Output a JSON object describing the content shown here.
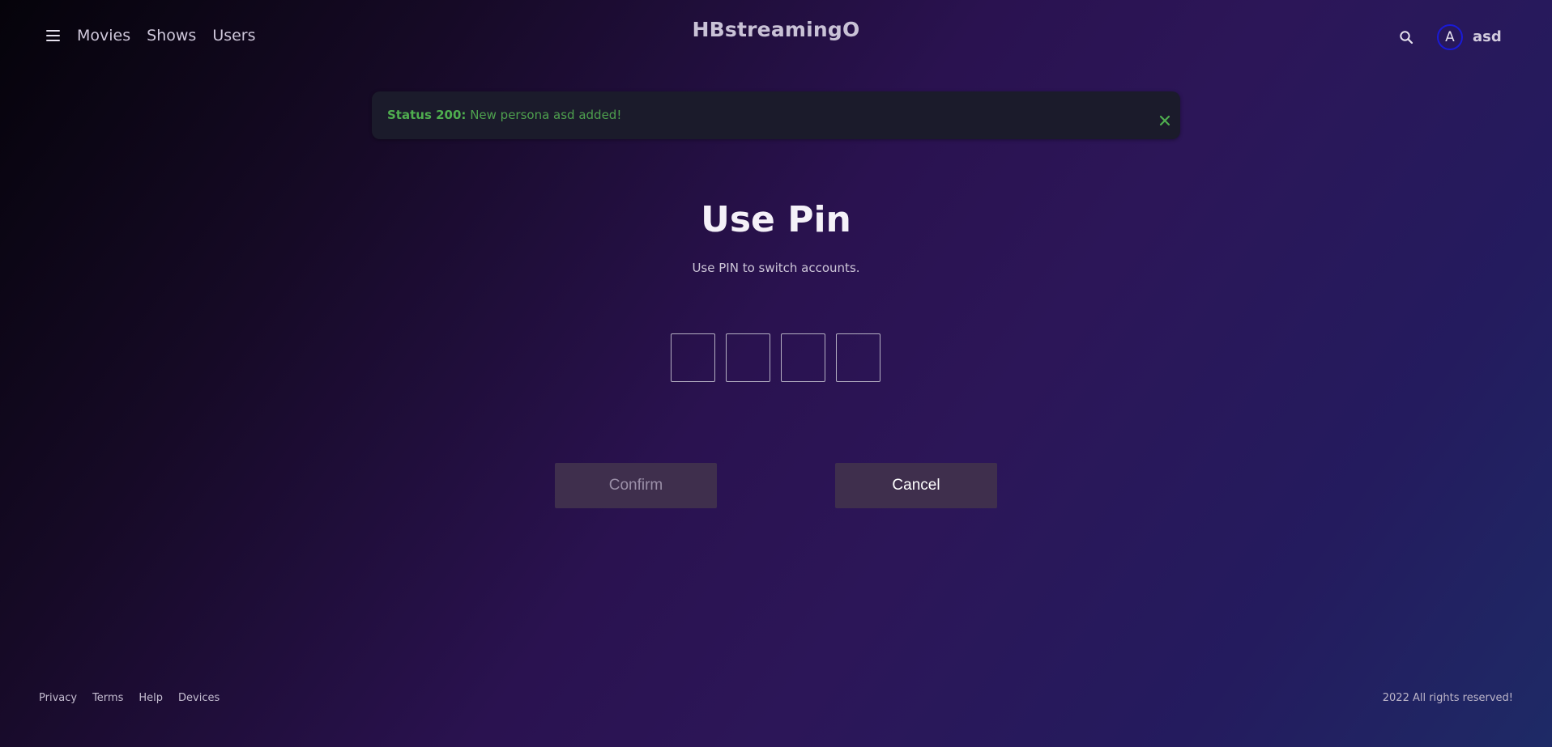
{
  "header": {
    "brand": "HBstreamingO",
    "nav": [
      "Movies",
      "Shows",
      "Users"
    ],
    "avatar_initial": "A",
    "username": "asd",
    "icons": {
      "menu": "hamburger-menu-icon",
      "search": "search-icon"
    }
  },
  "alert": {
    "status_label": "Status 200:",
    "message": "New persona asd added!",
    "color": "#4fae4f",
    "close_icon": "close-icon"
  },
  "main": {
    "title": "Use Pin",
    "subtitle": "Use PIN to switch accounts.",
    "pin_digits": [
      "",
      "",
      "",
      ""
    ],
    "confirm_label": "Confirm",
    "cancel_label": "Cancel"
  },
  "footer": {
    "links": [
      "Privacy",
      "Terms",
      "Help",
      "Devices"
    ],
    "copyright": "2022 All rights reserved!"
  },
  "colors": {
    "avatar_border": "#1a1ad6",
    "button_bg": "#3f2f4d",
    "alert_bg": "#1b1b2b"
  }
}
